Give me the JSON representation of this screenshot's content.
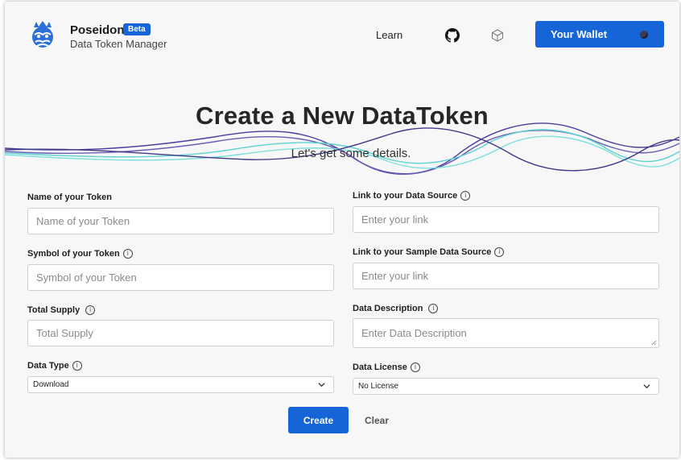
{
  "header": {
    "brand": "Poseidon",
    "badge": "Beta",
    "subtitle": "Data Token Manager",
    "nav": {
      "learn": "Learn"
    },
    "icons": [
      "github-icon",
      "cube-icon"
    ],
    "wallet_label": "Your Wallet"
  },
  "hero": {
    "title": "Create a New DataToken",
    "subtitle": "Let's get some details."
  },
  "form": {
    "token_name": {
      "label": "Name of your Token",
      "placeholder": "Name of your Token"
    },
    "token_symbol": {
      "label": "Symbol of your Token",
      "placeholder": "Symbol of your Token"
    },
    "total_supply": {
      "label": "Total Supply",
      "placeholder": "Total Supply"
    },
    "data_type": {
      "label": "Data Type",
      "value": "Download"
    },
    "data_source": {
      "label": "Link to your Data Source",
      "placeholder": "Enter your link"
    },
    "sample_source": {
      "label": "Link to your Sample Data Source",
      "placeholder": "Enter your link"
    },
    "description": {
      "label": "Data Description",
      "placeholder": "Enter Data Description"
    },
    "license": {
      "label": "Data License",
      "value": "No License"
    },
    "info_glyph": "i"
  },
  "actions": {
    "create": "Create",
    "clear": "Clear"
  },
  "colors": {
    "primary": "#1565d8",
    "wave_purple": "#4b3d9c",
    "wave_teal": "#5fd3d0",
    "background": "#f7f7f8"
  }
}
